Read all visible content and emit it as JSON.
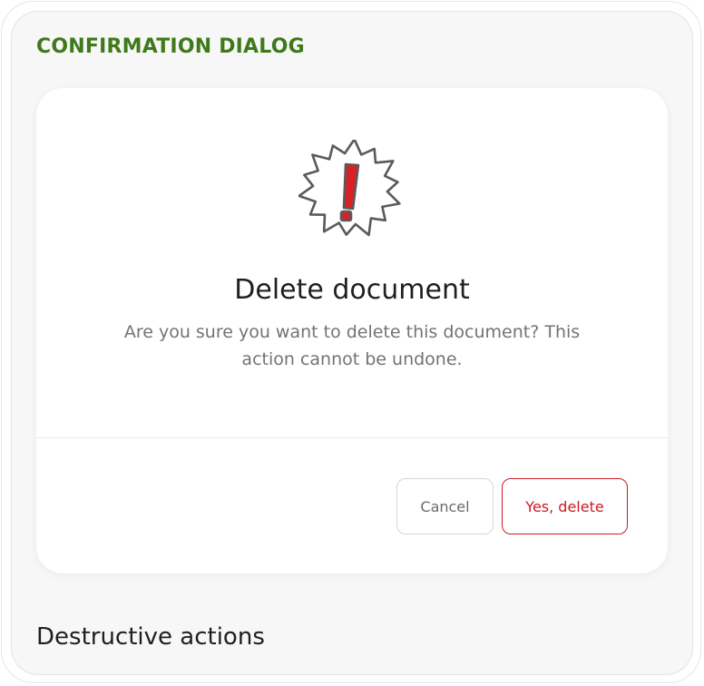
{
  "section": {
    "label": "CONFIRMATION DIALOG"
  },
  "dialog": {
    "icon": "alert-burst-icon",
    "title": "Delete document",
    "message": "Are you sure you want to delete this document? This action cannot be undone.",
    "cancel_label": "Cancel",
    "confirm_label": "Yes, delete"
  },
  "footer": {
    "text": "Destructive actions"
  },
  "colors": {
    "accent_green": "#3f7a1a",
    "danger_red": "#cc1b22",
    "icon_red": "#d92027",
    "icon_stroke": "#5a5a5a"
  }
}
